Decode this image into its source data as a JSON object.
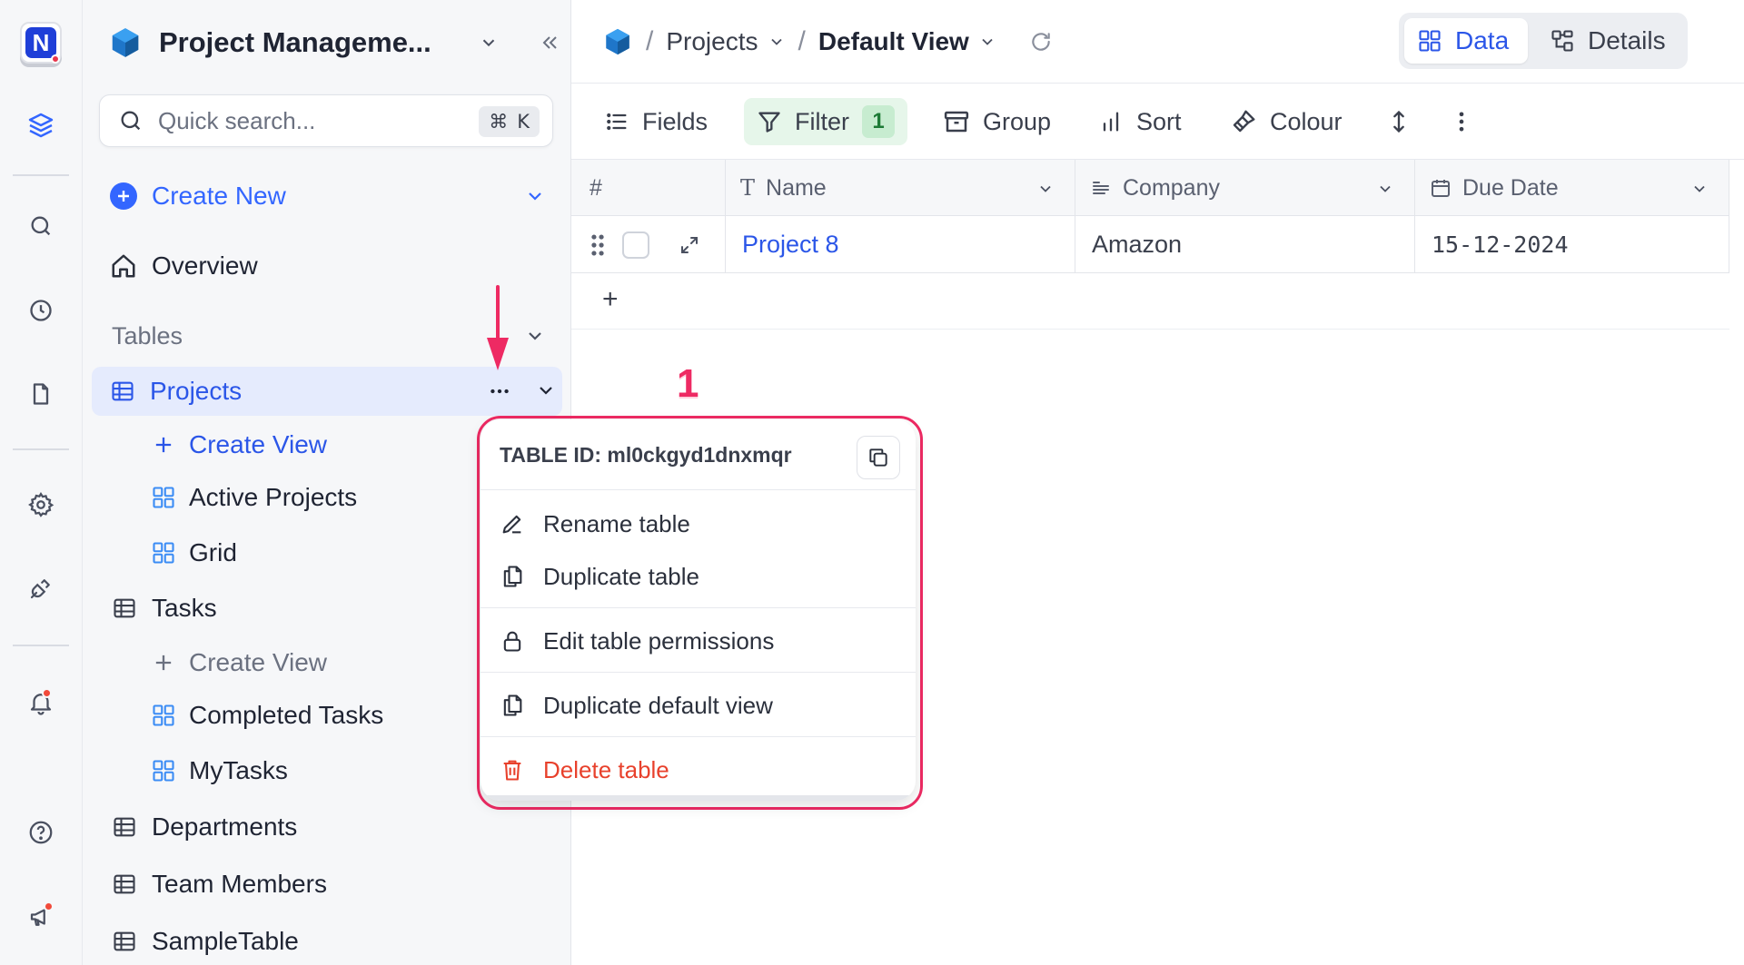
{
  "app": {
    "logo_letter": "N"
  },
  "sidebar": {
    "base_title": "Project Manageme...",
    "search": {
      "placeholder": "Quick search...",
      "shortcut_symbol": "⌘",
      "shortcut_key": "K"
    },
    "create_new": "Create New",
    "overview": "Overview",
    "tables_heading": "Tables",
    "tables": [
      {
        "label": "Projects",
        "active": true,
        "views": [
          {
            "label": "Create View",
            "kind": "create"
          },
          {
            "label": "Active Projects",
            "kind": "grid"
          },
          {
            "label": "Grid",
            "kind": "grid"
          }
        ]
      },
      {
        "label": "Tasks",
        "views": [
          {
            "label": "Create View",
            "kind": "create"
          },
          {
            "label": "Completed Tasks",
            "kind": "grid"
          },
          {
            "label": "MyTasks",
            "kind": "grid"
          }
        ]
      },
      {
        "label": "Departments"
      },
      {
        "label": "Team Members"
      },
      {
        "label": "SampleTable"
      }
    ]
  },
  "topbar": {
    "breadcrumb": [
      "Projects",
      "Default View"
    ],
    "tabs": [
      {
        "label": "Data",
        "active": true
      },
      {
        "label": "Details",
        "active": false
      }
    ]
  },
  "toolbar": {
    "fields": "Fields",
    "filter": "Filter",
    "filter_count": "1",
    "group": "Group",
    "sort": "Sort",
    "colour": "Colour"
  },
  "grid": {
    "columns": [
      "#",
      "Name",
      "Company",
      "Due Date"
    ],
    "rows": [
      {
        "name": "Project 8",
        "company": "Amazon",
        "due_date": "15-12-2024"
      }
    ],
    "add_row_symbol": "+"
  },
  "annotation": {
    "number": "1"
  },
  "context_menu": {
    "table_id": "TABLE ID: ml0ckgyd1dnxmqr",
    "items": [
      {
        "label": "Rename table",
        "icon": "pencil-icon"
      },
      {
        "label": "Duplicate table",
        "icon": "duplicate-icon"
      },
      {
        "label": "Edit table permissions",
        "icon": "lock-icon"
      },
      {
        "label": "Duplicate default view",
        "icon": "duplicate-icon"
      },
      {
        "label": "Delete table",
        "icon": "trash-icon",
        "danger": true
      }
    ]
  },
  "colors": {
    "accent": "#2b56e8",
    "annotation": "#ee2a63",
    "danger": "#e8412c",
    "filter_bg": "#e6f6ea"
  }
}
